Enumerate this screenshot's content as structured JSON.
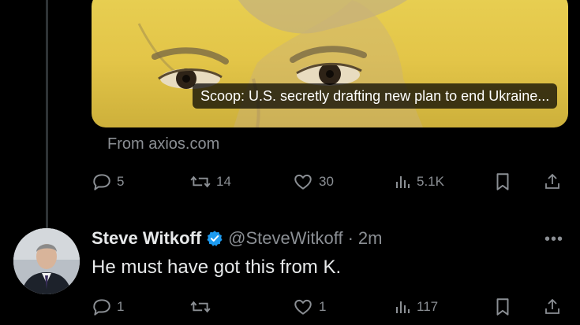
{
  "card": {
    "caption": "Scoop: U.S. secretly drafting new plan to end Ukraine...",
    "source": "From axios.com"
  },
  "post1": {
    "replies": "5",
    "reposts": "14",
    "likes": "30",
    "views": "5.1K"
  },
  "reply": {
    "name": "Steve Witkoff",
    "handle": "@SteveWitkoff",
    "separator": "·",
    "time": "2m",
    "text": "He must have got this from K.",
    "replies": "1",
    "likes": "1",
    "views": "117"
  },
  "colors": {
    "background": "#000000",
    "muted": "#8b8f94",
    "verified": "#1d9bf0",
    "card_yellow": "#e3c548"
  },
  "icons": [
    "reply-icon",
    "repost-icon",
    "like-icon",
    "views-icon",
    "bookmark-icon",
    "share-icon",
    "verified-badge-icon",
    "more-icon"
  ]
}
